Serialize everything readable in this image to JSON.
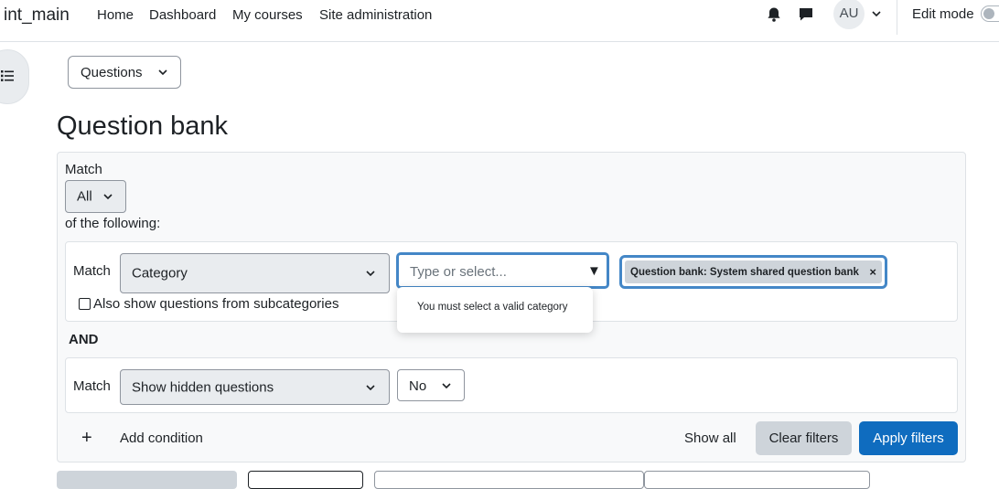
{
  "navbar": {
    "brand": "int_main",
    "links": [
      "Home",
      "Dashboard",
      "My courses",
      "Site administration"
    ],
    "avatar_initials": "AU",
    "edit_mode_label": "Edit mode",
    "icons": [
      "bell-icon",
      "chat-icon",
      "chevron-down-icon"
    ]
  },
  "page_switcher": {
    "selected": "Questions"
  },
  "page": {
    "title": "Question bank"
  },
  "filter": {
    "match_label": "Match",
    "match_value": "All",
    "of_following": "of the following:",
    "condition1": {
      "match_label": "Match",
      "type": "Category",
      "typeahead_placeholder": "Type or select...",
      "selected_tag": "Question bank: System shared question bank",
      "remove_symbol": "×",
      "error": "You must select a valid category",
      "subcategories_label": "Also show questions from subcategories"
    },
    "join_label": "AND",
    "condition2": {
      "match_label": "Match",
      "type": "Show hidden questions",
      "value": "No"
    },
    "add_condition_symbol": "+",
    "add_condition_label": "Add condition",
    "show_all_label": "Show all",
    "clear_filters_label": "Clear filters",
    "apply_filters_label": "Apply filters"
  },
  "colors": {
    "primary": "#0f6cbf",
    "focus_border": "#4487c7",
    "secondary": "#ced4da",
    "panel_bg": "#f8f9fa"
  }
}
